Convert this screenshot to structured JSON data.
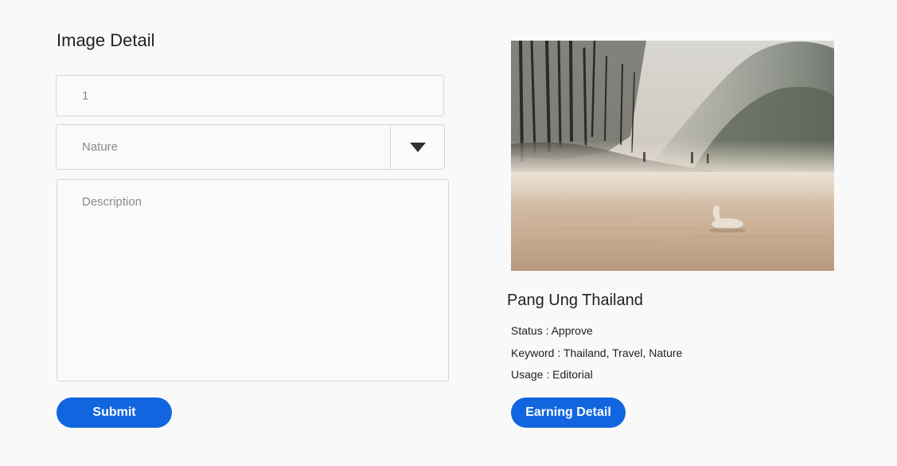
{
  "page": {
    "title": "Image Detail"
  },
  "form": {
    "id_value": "1",
    "category_value": "Nature",
    "description_placeholder": "Description",
    "submit_label": "Submit"
  },
  "image": {
    "title": "Pang Ung Thailand",
    "status_label": "Status :",
    "status_value": "Approve",
    "keyword_label": "Keyword :",
    "keyword_value": "Thailand, Travel, Nature",
    "usage_label": "Usage :",
    "usage_value": "Editorial",
    "earning_button_label": "Earning Detail"
  },
  "icons": {
    "dropdown": "triangle-down-icon"
  },
  "colors": {
    "accent": "#1166e0",
    "background": "#f9f9f9",
    "border": "#d6d6d6"
  }
}
